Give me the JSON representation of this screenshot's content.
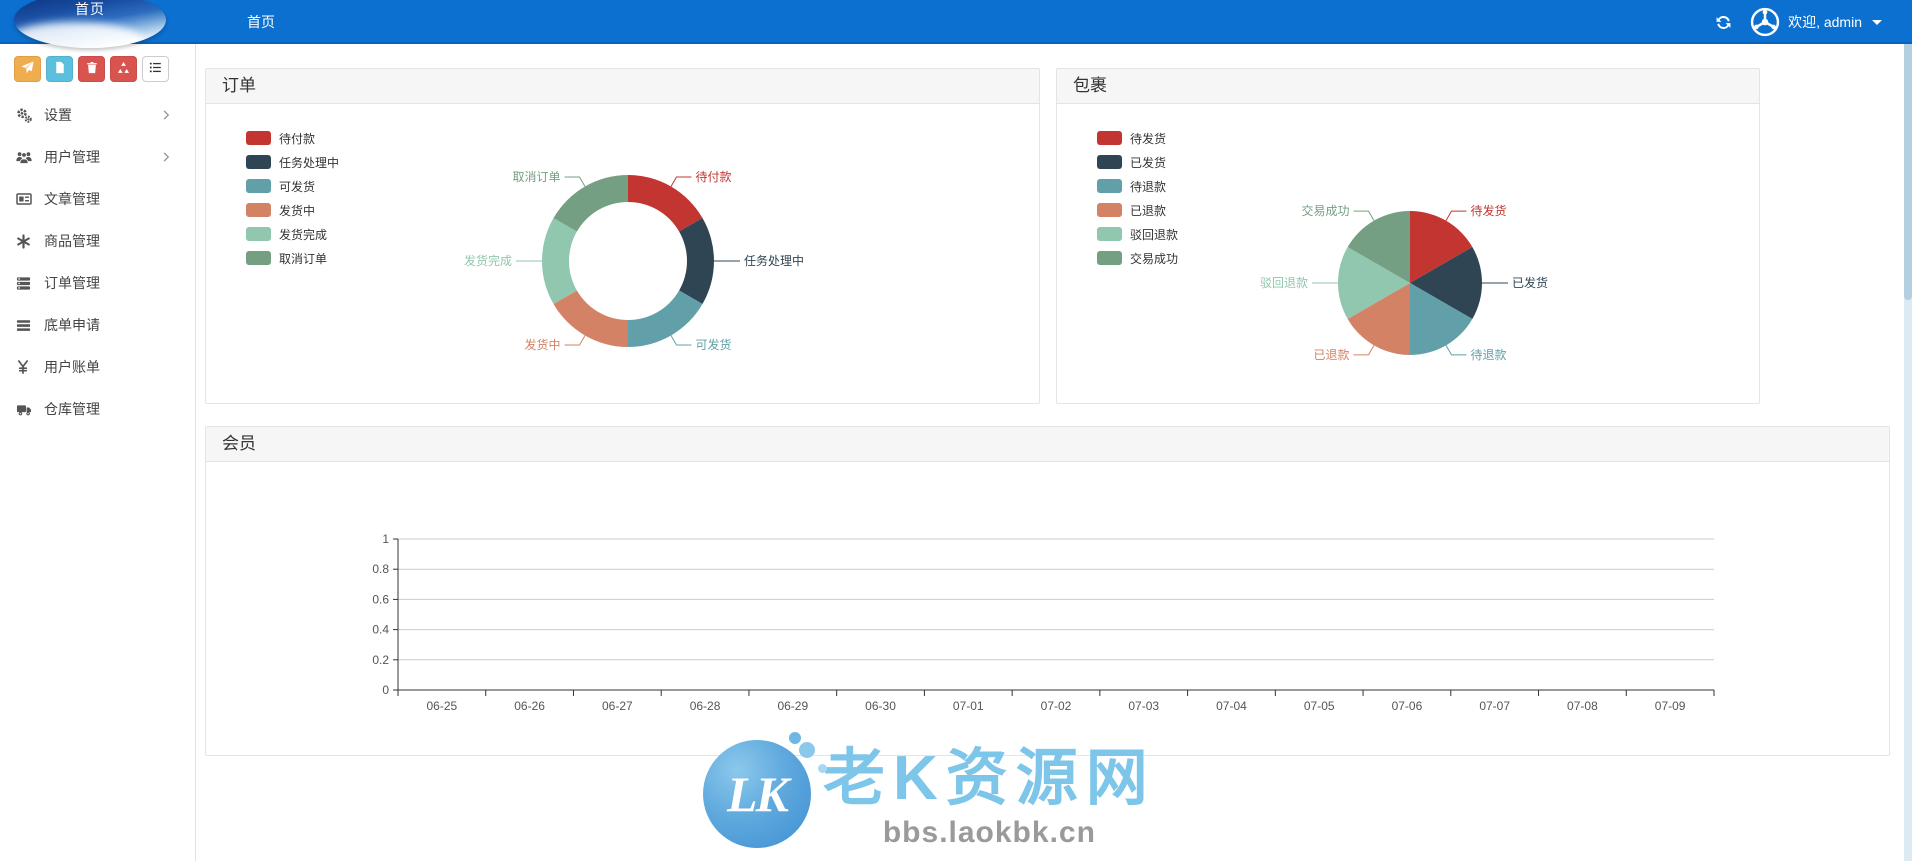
{
  "navbar": {
    "logo_text": "首页",
    "home_tab": "首页",
    "welcome": "欢迎, admin"
  },
  "toolbar": {
    "buttons": [
      {
        "icon": "paper-plane-icon",
        "color": "#f0ad4e"
      },
      {
        "icon": "file-icon",
        "color": "#5bc0de"
      },
      {
        "icon": "trash-icon",
        "color": "#d9534f"
      },
      {
        "icon": "recycle-icon",
        "color": "#d9534f"
      },
      {
        "icon": "list-icon",
        "color": "#ffffff"
      }
    ]
  },
  "sidebar": {
    "items": [
      {
        "label": "设置",
        "icon": "gears-icon",
        "expandable": true
      },
      {
        "label": "用户管理",
        "icon": "users-icon",
        "expandable": true
      },
      {
        "label": "文章管理",
        "icon": "newspaper-icon",
        "expandable": false
      },
      {
        "label": "商品管理",
        "icon": "asterisk-icon",
        "expandable": false
      },
      {
        "label": "订单管理",
        "icon": "server-icon",
        "expandable": false
      },
      {
        "label": "底单申请",
        "icon": "bars-icon",
        "expandable": false
      },
      {
        "label": "用户账单",
        "icon": "yen-icon",
        "expandable": false
      },
      {
        "label": "仓库管理",
        "icon": "truck-icon",
        "expandable": false
      }
    ]
  },
  "panels": {
    "orders_title": "订单",
    "packages_title": "包裹",
    "members_title": "会员"
  },
  "chart_data": [
    {
      "type": "pie",
      "variant": "donut",
      "title": "订单",
      "labels": [
        "待付款",
        "任务处理中",
        "可发货",
        "发货中",
        "发货完成",
        "取消订单"
      ],
      "values": [
        1,
        1,
        1,
        1,
        1,
        1
      ],
      "colors": [
        "#c23531",
        "#2f4554",
        "#61a0a8",
        "#d48265",
        "#91c7ae",
        "#749f83"
      ],
      "legend_position": "top-left"
    },
    {
      "type": "pie",
      "variant": "pie",
      "title": "包裹",
      "labels": [
        "待发货",
        "已发货",
        "待退款",
        "已退款",
        "驳回退款",
        "交易成功"
      ],
      "values": [
        1,
        1,
        1,
        1,
        1,
        1
      ],
      "colors": [
        "#c23531",
        "#2f4554",
        "#61a0a8",
        "#d48265",
        "#91c7ae",
        "#749f83"
      ],
      "legend_position": "top-left"
    },
    {
      "type": "line",
      "title": "会员",
      "x": [
        "06-25",
        "06-26",
        "06-27",
        "06-28",
        "06-29",
        "06-30",
        "07-01",
        "07-02",
        "07-03",
        "07-04",
        "07-05",
        "07-06",
        "07-07",
        "07-08",
        "07-09"
      ],
      "series": [],
      "ylim": [
        0,
        1
      ],
      "yticks": [
        0,
        0.2,
        0.4,
        0.6,
        0.8,
        1
      ],
      "grid": true,
      "legend_position": "none"
    }
  ],
  "watermark": {
    "badge": "LK",
    "title": "老K资源网",
    "url": "bbs.laokbk.cn"
  }
}
